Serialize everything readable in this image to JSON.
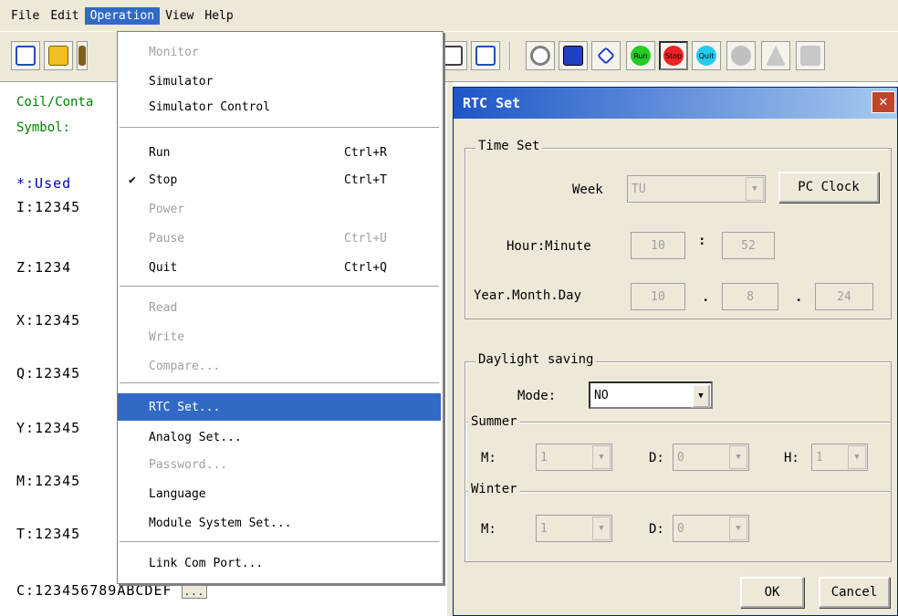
{
  "menubar": {
    "items": [
      "File",
      "Edit",
      "Operation",
      "View",
      "Help"
    ]
  },
  "toolbar": {
    "run_label": "Run",
    "stop_label": "Stop",
    "quit_label": "Quit"
  },
  "left_panel": {
    "coil_label": "Coil/Conta",
    "symbol_label": "Symbol:",
    "used_label": "*:Used",
    "rows": [
      "I:12345",
      "Z:1234",
      "X:12345",
      "Q:12345",
      "Y:12345",
      "M:12345",
      "T:12345",
      "C:123456789ABCDEF"
    ],
    "more_button": "..."
  },
  "operation_menu": {
    "items": [
      {
        "label": "Monitor",
        "shortcut": "",
        "disabled": true
      },
      {
        "label": "Simulator",
        "shortcut": "",
        "disabled": false
      },
      {
        "label": "Simulator Control",
        "shortcut": "",
        "disabled": false
      },
      {
        "label": "Run",
        "shortcut": "Ctrl+R",
        "disabled": false
      },
      {
        "label": "Stop",
        "shortcut": "Ctrl+T",
        "disabled": false,
        "checked": true
      },
      {
        "label": "Power",
        "shortcut": "",
        "disabled": true
      },
      {
        "label": "Pause",
        "shortcut": "Ctrl+U",
        "disabled": true
      },
      {
        "label": "Quit",
        "shortcut": "Ctrl+Q",
        "disabled": false
      },
      {
        "label": "Read",
        "shortcut": "",
        "disabled": true
      },
      {
        "label": "Write",
        "shortcut": "",
        "disabled": true
      },
      {
        "label": "Compare...",
        "shortcut": "",
        "disabled": true
      },
      {
        "label": "RTC Set...",
        "shortcut": "",
        "disabled": false,
        "highlighted": true
      },
      {
        "label": "Analog Set...",
        "shortcut": "",
        "disabled": false
      },
      {
        "label": "Password...",
        "shortcut": "",
        "disabled": true
      },
      {
        "label": "Language",
        "shortcut": "",
        "disabled": false
      },
      {
        "label": "Module System Set...",
        "shortcut": "",
        "disabled": false
      },
      {
        "label": "Link Com Port...",
        "shortcut": "",
        "disabled": false
      }
    ]
  },
  "dialog": {
    "title": "RTC Set",
    "time_set": {
      "group_label": "Time Set",
      "week_label": "Week",
      "week_value": "TU",
      "pc_clock_button": "PC Clock",
      "hour_minute_label": "Hour:Minute",
      "hour": "10",
      "minute": "52",
      "colon": ":",
      "ymd_label": "Year.Month.Day",
      "year": "10",
      "month": "8",
      "day": "24",
      "dot": "."
    },
    "daylight": {
      "group_label": "Daylight saving",
      "mode_label": "Mode:",
      "mode_value": "NO",
      "summer": {
        "label": "Summer",
        "m_label": "M:",
        "m_value": "1",
        "d_label": "D:",
        "d_value": "0",
        "h_label": "H:",
        "h_value": "1"
      },
      "winter": {
        "label": "Winter",
        "m_label": "M:",
        "m_value": "1",
        "d_label": "D:",
        "d_value": "0"
      }
    },
    "ok_button": "OK",
    "cancel_button": "Cancel"
  },
  "colors": {
    "menu_highlight": "#316ac5",
    "title_blue": "#1f56c7",
    "used_label": "#0000c0",
    "coil_label": "#008000",
    "run_icon": "#22cc22",
    "stop_icon": "#ee2222",
    "quit_icon": "#22ccee"
  }
}
